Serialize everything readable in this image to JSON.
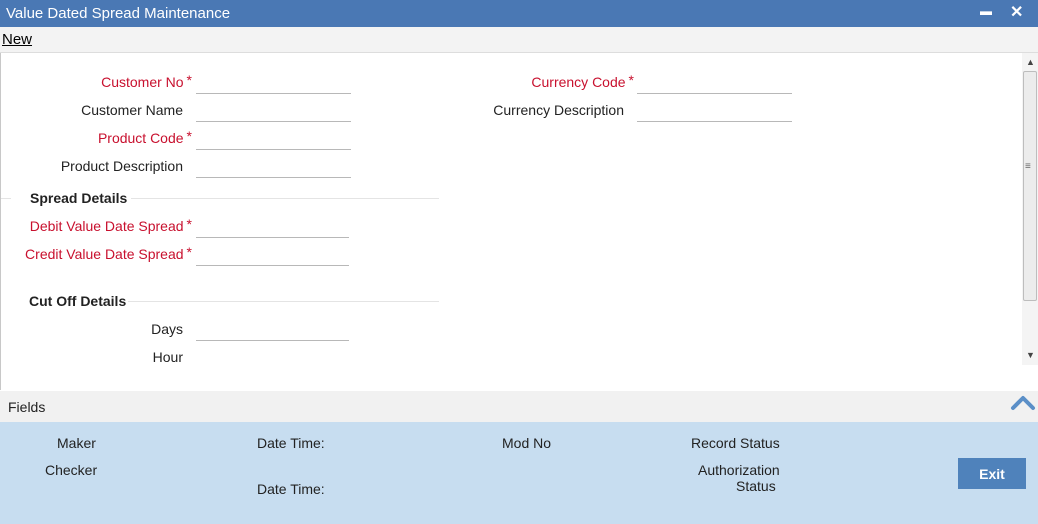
{
  "window": {
    "title": "Value Dated Spread Maintenance",
    "minimize": "▬",
    "close": "✕"
  },
  "menu": {
    "new_label": "New"
  },
  "form": {
    "customer_no": {
      "label": "Customer No",
      "required": "*",
      "value": ""
    },
    "customer_name": {
      "label": "Customer Name",
      "value": ""
    },
    "product_code": {
      "label": "Product Code",
      "required": "*",
      "value": ""
    },
    "product_description": {
      "label": "Product Description",
      "value": ""
    },
    "currency_code": {
      "label": "Currency Code",
      "required": "*",
      "value": ""
    },
    "currency_description": {
      "label": "Currency Description",
      "value": ""
    }
  },
  "spread_details": {
    "heading": "Spread Details",
    "debit": {
      "label": "Debit Value Date Spread",
      "required": "*",
      "value": ""
    },
    "credit": {
      "label": "Credit Value Date Spread",
      "required": "*",
      "value": ""
    }
  },
  "cutoff_details": {
    "heading": "Cut Off Details",
    "days": {
      "label": "Days",
      "value": ""
    },
    "hour": {
      "label": "Hour"
    }
  },
  "fields_bar": {
    "label": "Fields"
  },
  "footer": {
    "maker": "Maker",
    "checker": "Checker",
    "date_time_1": "Date Time:",
    "date_time_2": "Date Time:",
    "mod_no": "Mod No",
    "record_status": "Record Status",
    "authorization_status_line1": "Authorization",
    "authorization_status_line2": "Status",
    "exit_label": "Exit"
  },
  "colors": {
    "titlebar": "#4a78b4",
    "required": "#c8102e",
    "footer": "#c7ddf0",
    "exit_button": "#4f82bb"
  }
}
